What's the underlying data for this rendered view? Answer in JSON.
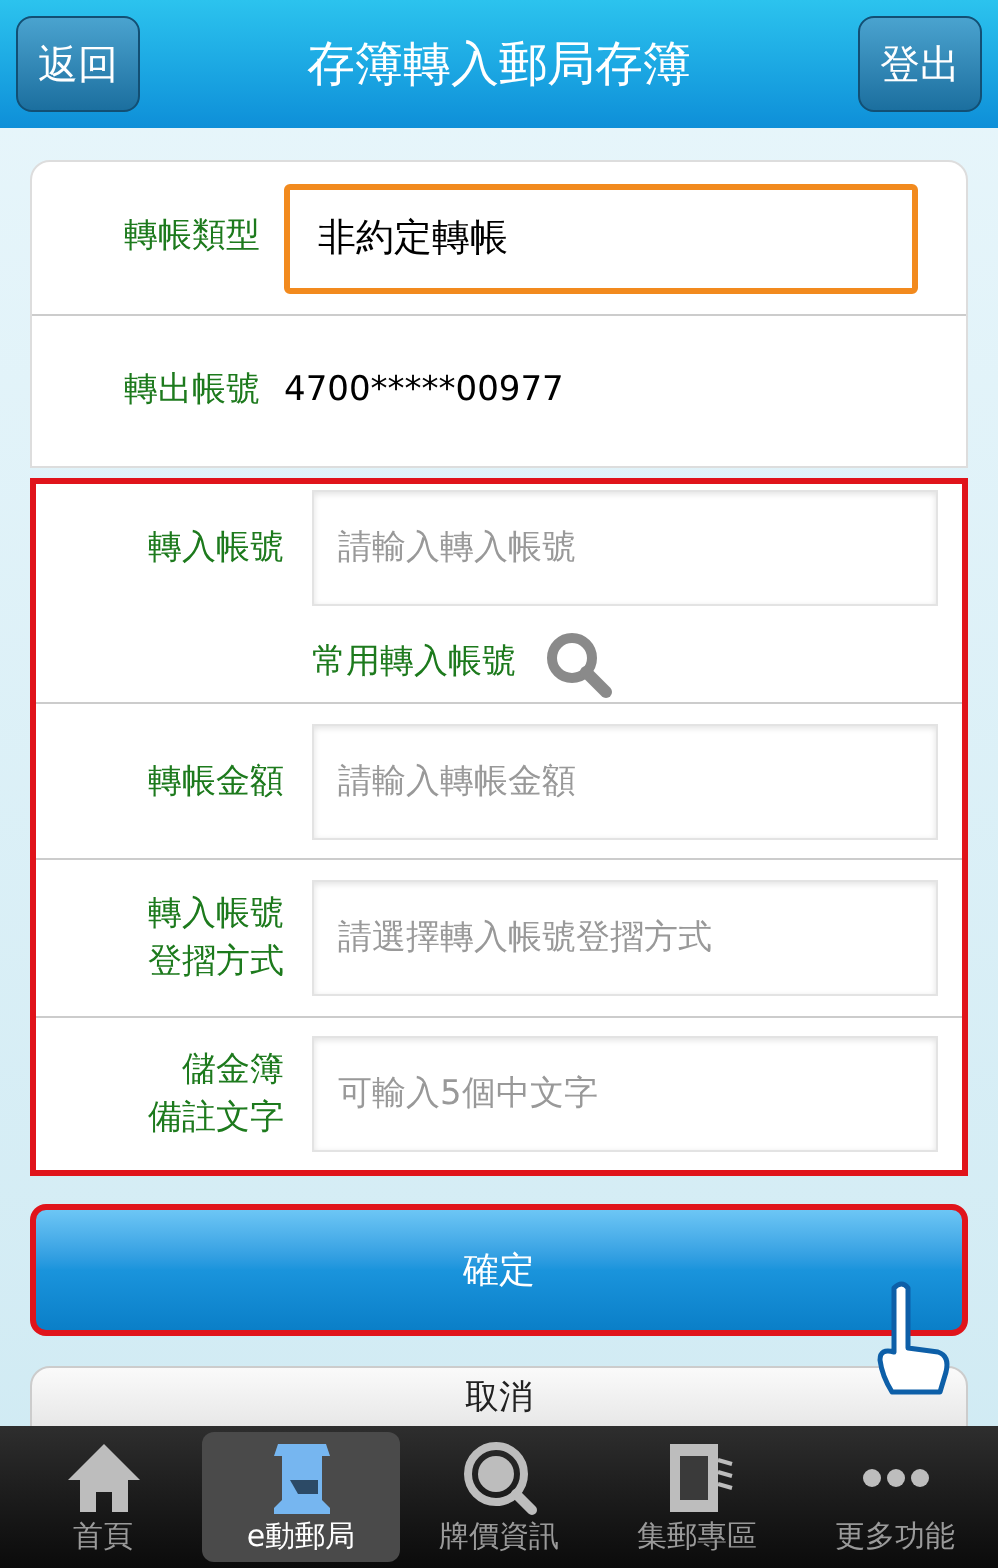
{
  "header": {
    "back_button": "返回",
    "title": "存簿轉入郵局存簿",
    "logout_button": "登出"
  },
  "summary": [
    {
      "kind": "select",
      "label": "轉帳類型",
      "value": "非約定轉帳",
      "focused": true
    },
    {
      "kind": "text",
      "label": "轉出帳號",
      "value": "4700*****00977"
    }
  ],
  "form": {
    "highlighted": true,
    "fields": [
      {
        "label": "轉入帳號",
        "placeholder": "請輸入轉入帳號",
        "link": "常用轉入帳號"
      },
      {
        "label": "轉帳金額",
        "placeholder": "請輸入轉帳金額"
      },
      {
        "label_lines": [
          "轉入帳號",
          "登摺方式"
        ],
        "placeholder": "請選擇轉入帳號登摺方式"
      },
      {
        "label_lines": [
          "儲金簿",
          "備註文字"
        ],
        "placeholder": "可輸入5個中文字"
      }
    ]
  },
  "confirm_button": {
    "label": "確定",
    "highlighted": true
  },
  "cancel_button": "取消",
  "tab_bar": [
    {
      "label": "首頁",
      "kind": "home",
      "selected": false
    },
    {
      "label": "e動郵局",
      "kind": "post",
      "selected": true
    },
    {
      "label": "牌價資訊",
      "kind": "dollar",
      "selected": false
    },
    {
      "label": "集郵專區",
      "kind": "stamp",
      "selected": false
    },
    {
      "label": "更多功能",
      "kind": "more",
      "selected": false
    }
  ]
}
